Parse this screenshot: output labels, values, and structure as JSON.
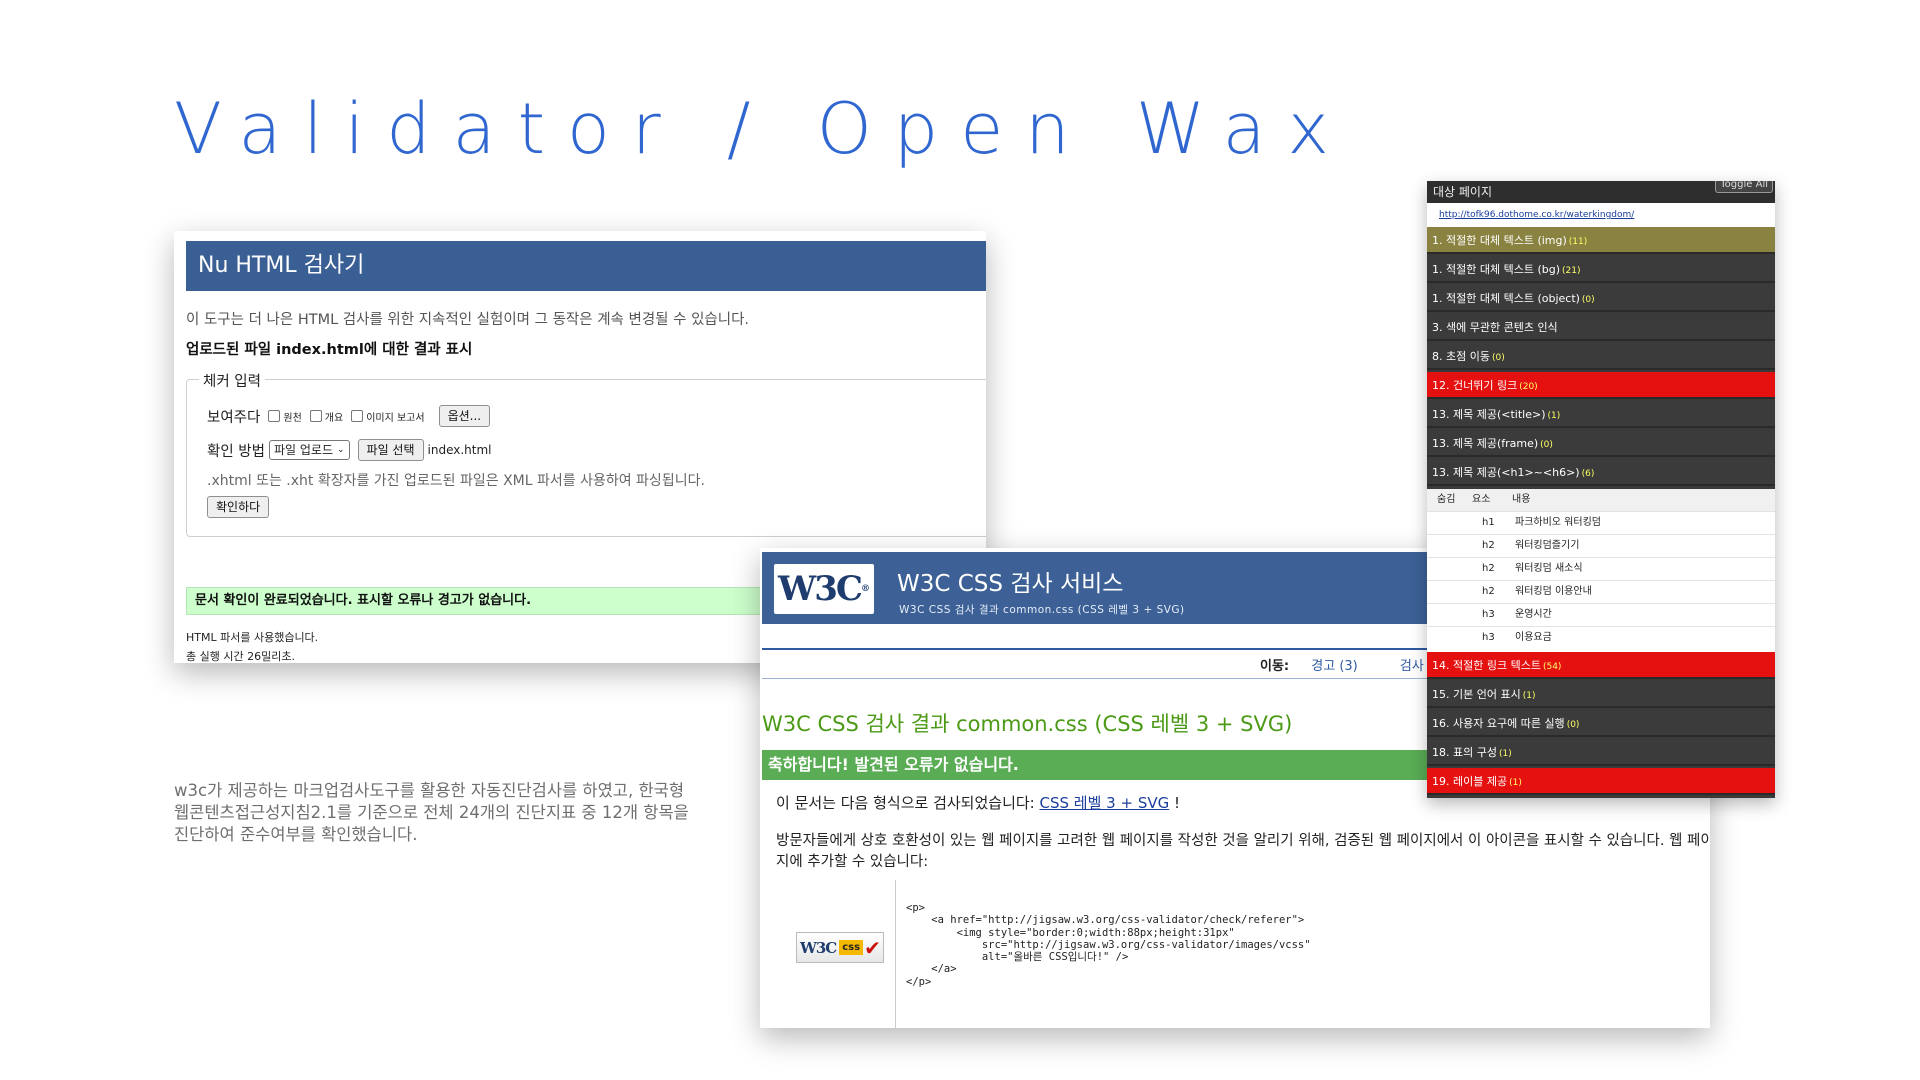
{
  "slide": {
    "title": "Validator / Open Wax",
    "description": "w3c가 제공하는 마크업검사도구를 활용한 자동진단검사를 하였고, 한국형웹콘텐츠접근성지침2.1를 기준으로 전체 24개의 진단지표 중 12개 항목을 진단하여 준수여부를 확인했습니다."
  },
  "nu": {
    "header": "Nu HTML 검사기",
    "note": "이 도구는 더 나은 HTML 검사를 위한 지속적인 실험이며 그 동작은 계속 변경될 수 있습니다.",
    "result_title": "업로드된 파일 index.html에 대한 결과 표시",
    "legend": "체커 입력",
    "show_label": "보여주다",
    "checkbox_source": "원천",
    "checkbox_outline": "개요",
    "checkbox_image_report": "이미지 보고서",
    "options_button": "옵션...",
    "method_label": "확인 방법",
    "method_select": "파일 업로드",
    "file_button": "파일 선택",
    "file_name": "index.html",
    "xhtml_note": ".xhtml 또는 .xht 확장자를 가진 업로드된 파일은 XML 파서를 사용하여 파싱됩니다.",
    "check_button": "확인하다",
    "success_message": "문서 확인이 완료되었습니다. 표시할 오류나 경고가 없습니다.",
    "parser_note": "HTML 파서를 사용했습니다.",
    "time_note": "총 실행 시간 26밀리초."
  },
  "w3c": {
    "logo": "W3C",
    "title": "W3C CSS 검사 서비스",
    "subtitle": "W3C CSS 검사 결과 common.css (CSS 레벨 3 + SVG)",
    "nav_label": "이동:",
    "nav_warnings": "경고 (3)",
    "nav_validated": "검사",
    "result_title": "W3C CSS 검사 결과 common.css (CSS 레벨 3 + SVG)",
    "congrats": "축하합니다! 발견된 오류가 없습니다.",
    "format_prefix": "이 문서는 다음 형식으로 검사되었습니다:",
    "format_link": "CSS 레벨 3 + SVG",
    "format_suffix": "!",
    "visitors_text": "방문자들에게 상호 호환성이 있는 웹 페이지를 고려한 웹 페이지를 작성한 것을 알리기 위해, 검증된 웹 페이지에서 이 아이콘을 표시할 수 있습니다. 웹 페이지에 추가할 수 있습니다:",
    "code": "<p>\n    <a href=\"http://jigsaw.w3.org/css-validator/check/referer\">\n        <img style=\"border:0;width:88px;height:31px\"\n            src=\"http://jigsaw.w3.org/css-validator/images/vcss\"\n            alt=\"올바른 CSS입니다!\" />\n    </a>\n</p>",
    "badge_w3c": "W3C",
    "badge_css": "css"
  },
  "wax": {
    "target_label": "대상 페이지",
    "toggle_label": "Toggle All",
    "url": "http://tofk96.dothome.co.kr/waterkingdom/",
    "items": [
      {
        "label": "1. 적절한 대체 텍스트 (img)",
        "count": "(11)"
      },
      {
        "label": "1. 적절한 대체 텍스트 (bg)",
        "count": "(21)"
      },
      {
        "label": "1. 적절한 대체 텍스트 (object)",
        "count": "(0)"
      },
      {
        "label": "3. 색에 무관한 콘텐츠 인식",
        "count": ""
      },
      {
        "label": "8. 초점 이동",
        "count": "(0)"
      },
      {
        "label": "12. 건너뛰기 링크",
        "count": "(20)"
      },
      {
        "label": "13. 제목 제공(<title>)",
        "count": "(1)"
      },
      {
        "label": "13. 제목 제공(frame)",
        "count": "(0)"
      },
      {
        "label": "13. 제목 제공(<h1>~<h6>)",
        "count": "(6)"
      },
      {
        "label": "14. 적절한 링크 텍스트",
        "count": "(54)"
      },
      {
        "label": "15. 기본 언어 표시",
        "count": "(1)"
      },
      {
        "label": "16. 사용자 요구에 따른 실행",
        "count": "(0)"
      },
      {
        "label": "18. 표의 구성",
        "count": "(1)"
      },
      {
        "label": "19. 레이블 제공",
        "count": "(1)"
      }
    ],
    "table": {
      "headers": [
        "숨김",
        "요소",
        "내용"
      ],
      "rows": [
        {
          "tag": "h1",
          "content": "파크하비오 워터킹덤"
        },
        {
          "tag": "h2",
          "content": "워터킹덤즐기기"
        },
        {
          "tag": "h2",
          "content": "워터킹덤 새소식"
        },
        {
          "tag": "h2",
          "content": "워터킹덤 이용안내"
        },
        {
          "tag": "h3",
          "content": "운영시간"
        },
        {
          "tag": "h3",
          "content": "이용요금"
        }
      ]
    }
  }
}
